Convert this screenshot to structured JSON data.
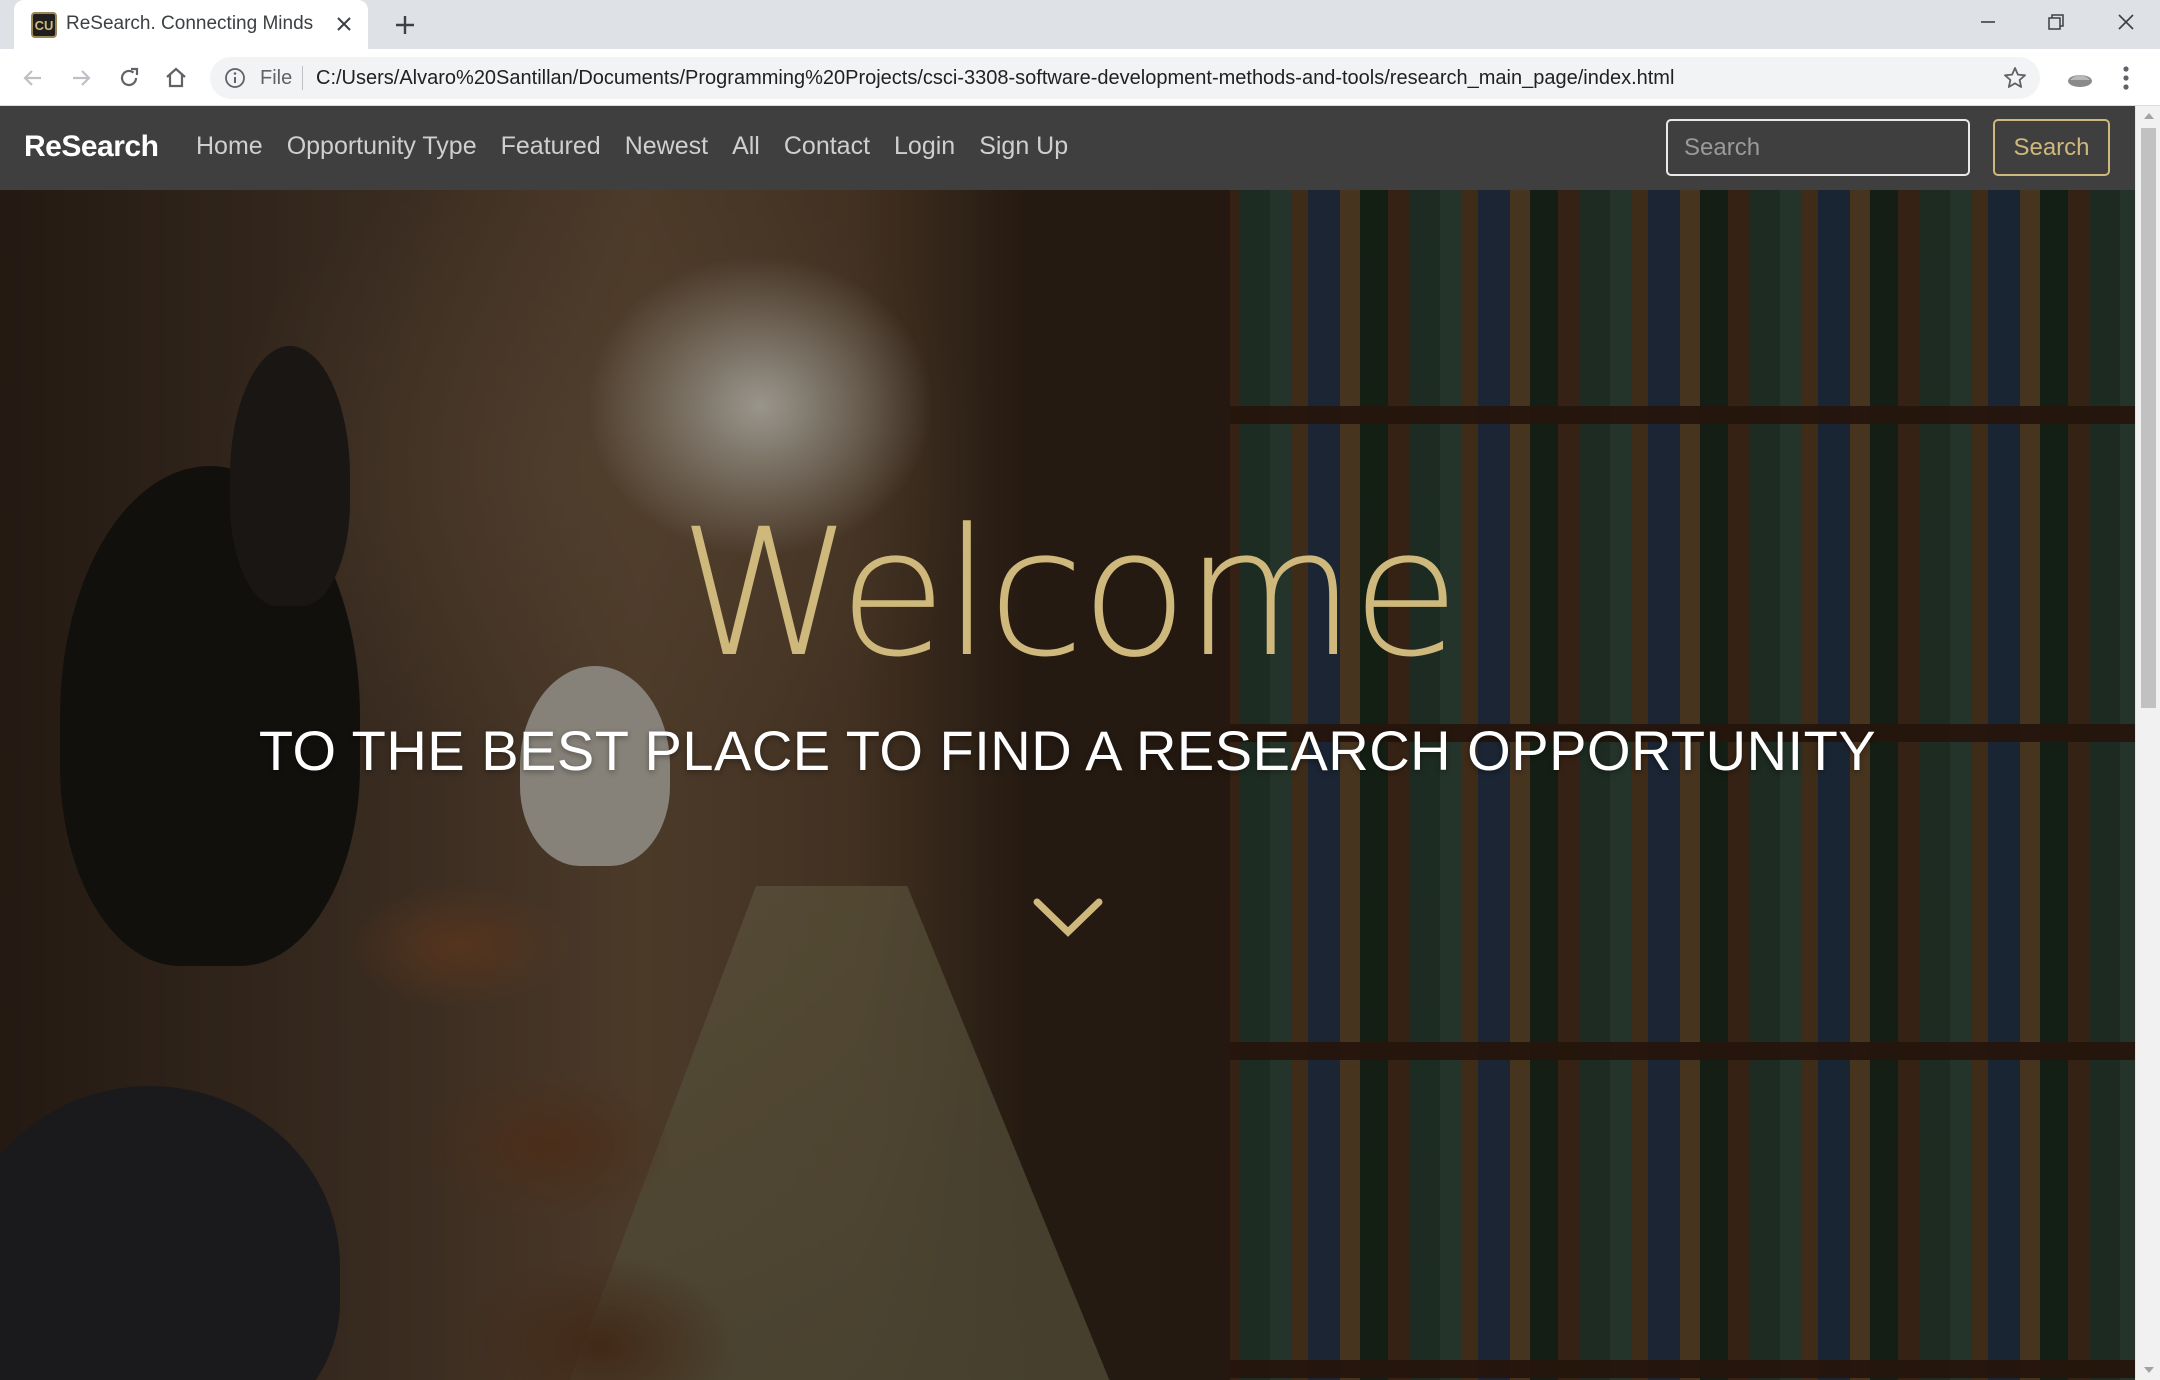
{
  "browser": {
    "tab_title": "ReSearch. Connecting Minds",
    "favicon_text": "CU",
    "scheme_label": "File",
    "url": "C:/Users/Alvaro%20Santillan/Documents/Programming%20Projects/csci-3308-software-development-methods-and-tools/research_main_page/index.html"
  },
  "navbar": {
    "brand": "ReSearch",
    "links": [
      "Home",
      "Opportunity Type",
      "Featured",
      "Newest",
      "All",
      "Contact",
      "Login",
      "Sign Up"
    ],
    "search_placeholder": "Search",
    "search_button": "Search"
  },
  "hero": {
    "welcome": "Welcome",
    "subtitle": "TO THE BEST PLACE TO FIND A RESEARCH OPPORTUNITY"
  },
  "colors": {
    "accent_gold": "#cfb87c",
    "navbar_bg": "#3f3f3f",
    "tabstrip_bg": "#dee1e6"
  },
  "icons": [
    "favicon",
    "close-icon",
    "plus-icon",
    "minimize-icon",
    "restore-icon",
    "close-window-icon",
    "back-arrow-icon",
    "forward-arrow-icon",
    "reload-icon",
    "home-icon",
    "info-icon",
    "star-icon",
    "extension-icon",
    "menu-dots-icon",
    "chevron-down-icon"
  ]
}
